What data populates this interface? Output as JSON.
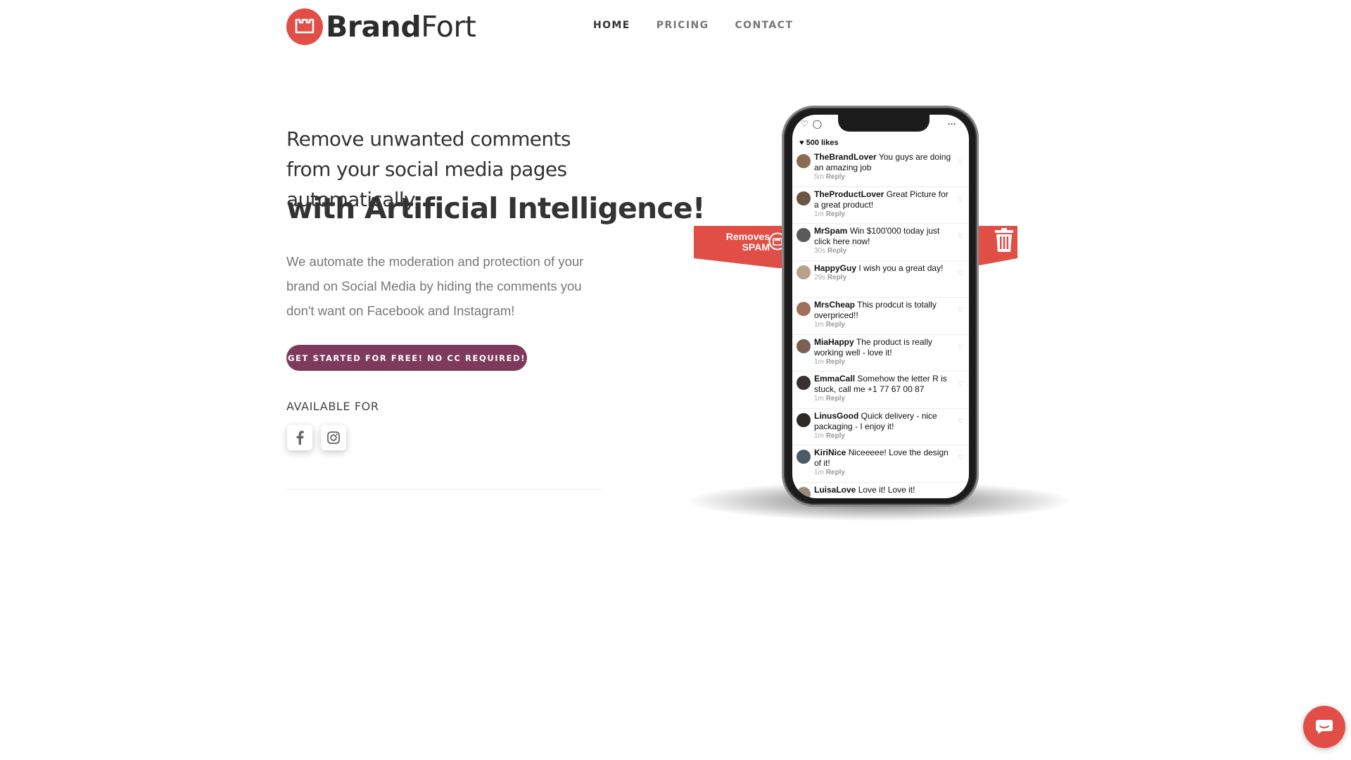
{
  "header": {
    "brand_bold": "Brand",
    "brand_light": "Fort",
    "nav": [
      "HOME",
      "PRICING",
      "CONTACT"
    ]
  },
  "hero": {
    "headline": "Remove unwanted comments from your social media pages automatically",
    "headline2": "with Artificial Intelligence!",
    "description": "We automate the moderation and protection of your brand on Social Media by hiding the comments you don't want on Facebook and Instagram!",
    "cta": "GET STARTED FOR FREE! NO CC REQUIRED!",
    "available_for": "AVAILABLE FOR",
    "platforms": [
      "facebook-icon",
      "instagram-icon"
    ]
  },
  "phone": {
    "likes": "500 likes",
    "ribbon_label_1": "Removes",
    "ribbon_label_2": "SPAM",
    "comments": [
      {
        "user": "TheBrandLover",
        "text": "You guys are doing an amazing job",
        "time": "5m",
        "reply": "Reply",
        "avatar": "#8a6a52"
      },
      {
        "user": "TheProductLover",
        "text": "Great Picture for a great product!",
        "time": "1m",
        "reply": "Reply",
        "avatar": "#6b5545"
      },
      {
        "user": "MrSpam",
        "text": "Win $100'000 today just click here now!",
        "time": "30s",
        "reply": "Reply",
        "avatar": "#5a5a5a"
      },
      {
        "user": "HappyGuy",
        "text": "I wish you a great day!",
        "time": "29s",
        "reply": "Reply",
        "avatar": "#b9a08a"
      },
      {
        "user": "MrsCheap",
        "text": "This prodcut is totally overpriced!!",
        "time": "1m",
        "reply": "Reply",
        "avatar": "#a0705a"
      },
      {
        "user": "MiaHappy",
        "text": "The product is really working well - love it!",
        "time": "1m",
        "reply": "Reply",
        "avatar": "#7a6050"
      },
      {
        "user": "EmmaCall",
        "text": "Somehow the letter R is stuck, call me +1 77 67 00 87",
        "time": "1m",
        "reply": "Reply",
        "avatar": "#3a3030"
      },
      {
        "user": "LinusGood",
        "text": "Quick delivery - nice packaging - I enjoy it!",
        "time": "1m",
        "reply": "Reply",
        "avatar": "#2e2a28"
      },
      {
        "user": "KiriNice",
        "text": "Niceeeee! Love the design of it!",
        "time": "1m",
        "reply": "Reply",
        "avatar": "#4d5a66"
      },
      {
        "user": "LuisaLove",
        "text": "Love it! Love it!",
        "time": "",
        "reply": "",
        "avatar": "#9a8a7a"
      }
    ]
  },
  "colors": {
    "brand_red": "#e04e45",
    "cta_purple": "#7e3a5c"
  }
}
